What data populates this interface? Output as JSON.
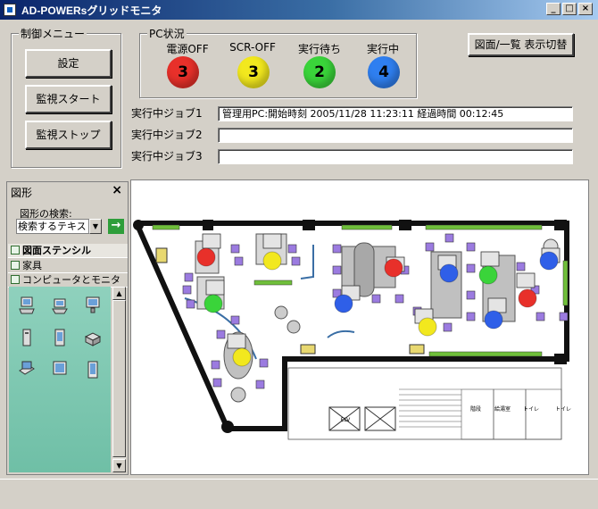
{
  "window": {
    "title": "AD-POWERsグリッドモニタ",
    "controls": [
      "_",
      "□",
      "×"
    ]
  },
  "control_menu": {
    "label": "制御メニュー",
    "buttons": [
      "設定",
      "監視スタート",
      "監視ストップ"
    ]
  },
  "pc_status": {
    "label": "PC状況",
    "items": [
      {
        "label": "電源OFF",
        "count": "3",
        "color": "#e8302a"
      },
      {
        "label": "SCR-OFF",
        "count": "3",
        "color": "#f2e81e"
      },
      {
        "label": "実行待ち",
        "count": "2",
        "color": "#3ad43a"
      },
      {
        "label": "実行中",
        "count": "4",
        "color": "#2f7ff0"
      }
    ]
  },
  "toggle_button": {
    "label": "図面/一覧 表示切替"
  },
  "jobs": [
    {
      "label": "実行中ジョブ1",
      "value": "管理用PC:開始時刻  2005/11/28  11:23:11  経過時間  00:12:45"
    },
    {
      "label": "実行中ジョブ2",
      "value": ""
    },
    {
      "label": "実行中ジョブ3",
      "value": ""
    }
  ],
  "shapes_panel": {
    "title": "図形",
    "close": "×",
    "search_label": "図形の検索:",
    "search_placeholder": "検索するテキス",
    "go_icon": "→",
    "stencils": [
      "図面ステンシル",
      "家具",
      "コンピュータとモニタ"
    ]
  },
  "floor_plan": {
    "room_labels": [
      "ELV",
      "階段",
      "給湯室",
      "トイレ",
      "トイレ"
    ],
    "pcs": [
      {
        "status": "red"
      },
      {
        "status": "yellow"
      },
      {
        "status": "green"
      },
      {
        "status": "yellow"
      },
      {
        "status": "blue"
      },
      {
        "status": "red"
      },
      {
        "status": "yellow"
      },
      {
        "status": "blue"
      },
      {
        "status": "green"
      },
      {
        "status": "red"
      },
      {
        "status": "blue"
      },
      {
        "status": "blue"
      }
    ],
    "colors": {
      "red": "#e8302a",
      "yellow": "#f2e81e",
      "green": "#3ad43a",
      "blue": "#2f5fe8"
    }
  }
}
